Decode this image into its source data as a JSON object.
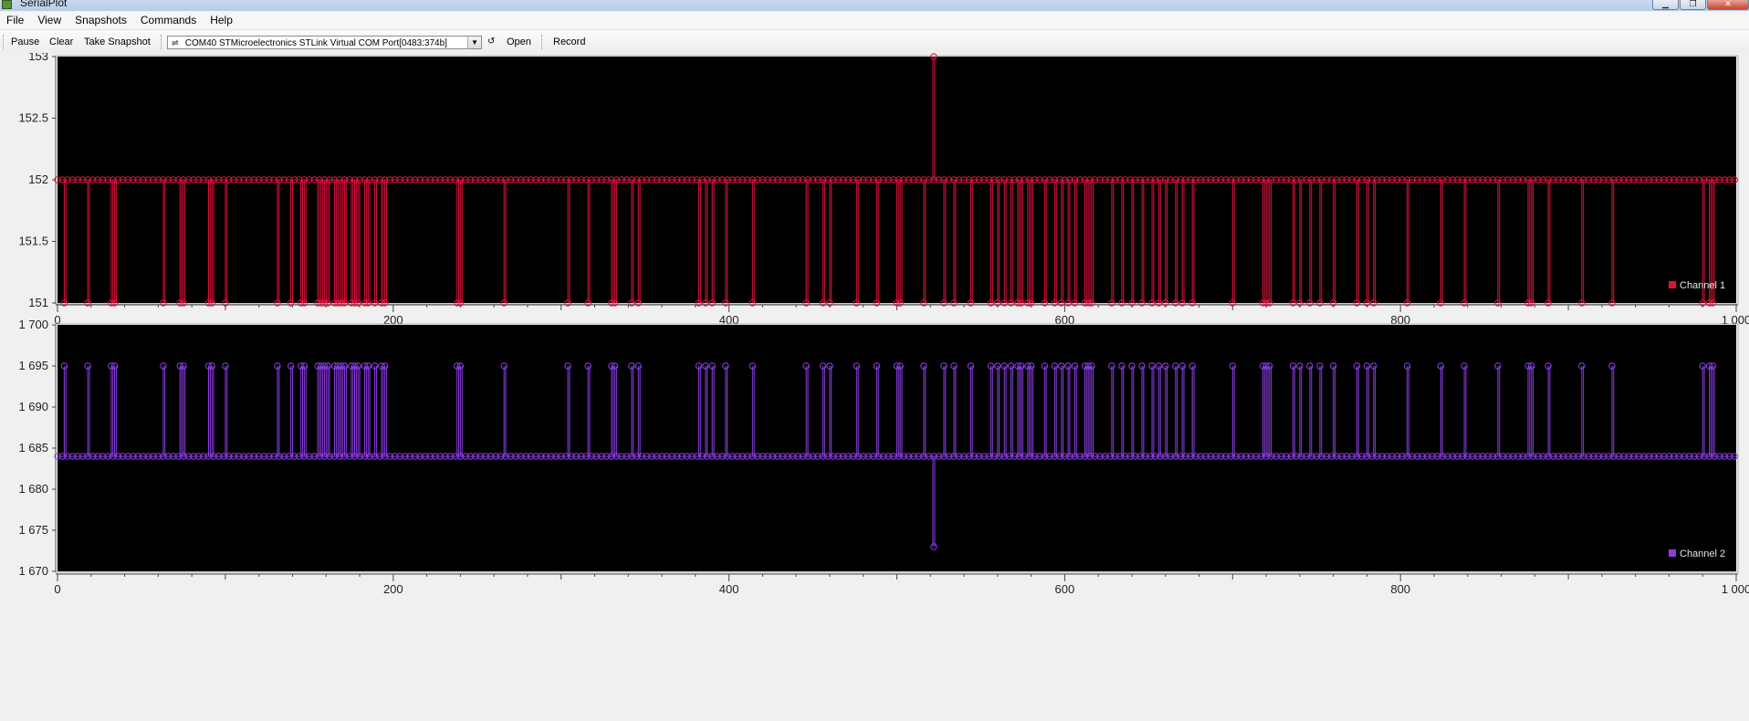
{
  "window": {
    "title": "SerialPlot"
  },
  "menu": [
    "File",
    "View",
    "Snapshots",
    "Commands",
    "Help"
  ],
  "toolbar": {
    "pause": "Pause",
    "clear": "Clear",
    "snapshot": "Take Snapshot",
    "port": "COM40 STMicroelectronics STLink Virtual COM Port[0483:374b]",
    "open": "Open",
    "record": "Record"
  },
  "colors": {
    "ch1": "#dc143c",
    "ch2": "#8a3ee0",
    "plot_bg": "#000000"
  },
  "chart_data": [
    {
      "type": "line",
      "series": [
        {
          "name": "Channel 1",
          "baseline": 152,
          "alt_value": 151,
          "spike": 153
        }
      ],
      "x_tick_labels": [
        "0",
        "200",
        "400",
        "600",
        "800",
        "1 000"
      ],
      "y_tick_labels": [
        "153",
        "152.5",
        "152",
        "151.5",
        "151"
      ],
      "ylim": [
        151,
        153
      ],
      "xlim": [
        0,
        1000
      ],
      "legend": "bottom-right"
    },
    {
      "type": "line",
      "series": [
        {
          "name": "Channel 2",
          "baseline": 1684,
          "alt_value": 1695,
          "spike": 1673
        }
      ],
      "x_tick_labels": [
        "0",
        "200",
        "400",
        "600",
        "800",
        "1 000"
      ],
      "y_tick_labels": [
        "1 700",
        "1 695",
        "1 690",
        "1 685",
        "1 680",
        "1 675",
        "1 670"
      ],
      "ylim": [
        1670,
        1700
      ],
      "xlim": [
        0,
        1000
      ],
      "legend": "bottom-right",
      "spike_index": 522,
      "event_indices": [
        4,
        18,
        32,
        34,
        63,
        73,
        75,
        90,
        92,
        100,
        131,
        139,
        145,
        147,
        155,
        157,
        159,
        161,
        165,
        167,
        169,
        171,
        175,
        177,
        179,
        183,
        185,
        189,
        193,
        195,
        238,
        240,
        266,
        304,
        316,
        330,
        332,
        342,
        346,
        382,
        386,
        390,
        398,
        414,
        446,
        456,
        460,
        476,
        488,
        500,
        502,
        516,
        528,
        534,
        544,
        556,
        560,
        564,
        568,
        572,
        574,
        578,
        580,
        588,
        594,
        598,
        602,
        606,
        612,
        614,
        616,
        628,
        634,
        640,
        646,
        652,
        656,
        660,
        666,
        670,
        676,
        700,
        718,
        720,
        722,
        736,
        740,
        746,
        752,
        760,
        774,
        780,
        784,
        804,
        824,
        838,
        858,
        876,
        878,
        888,
        908,
        926,
        980,
        984,
        986
      ]
    }
  ]
}
